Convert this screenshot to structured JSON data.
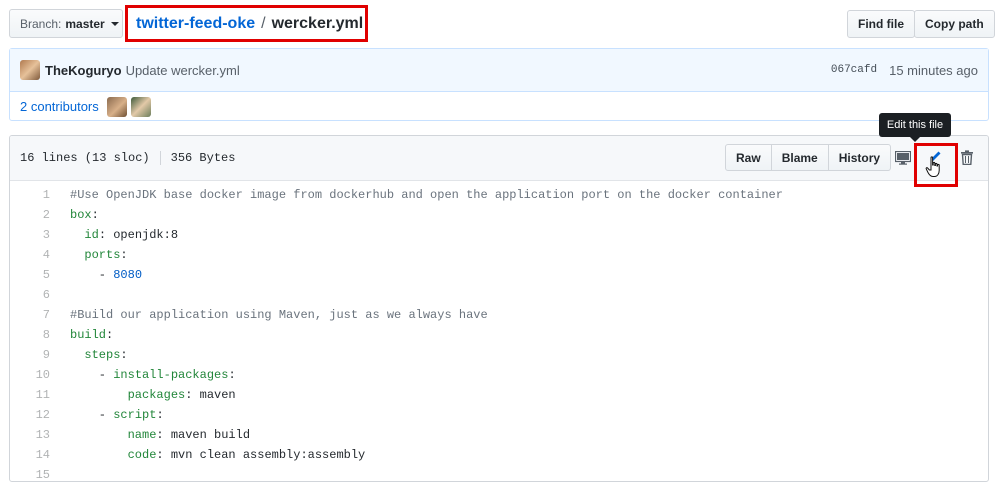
{
  "branch": {
    "prefix": "Branch:",
    "name": "master"
  },
  "breadcrumb": {
    "repo": "twitter-feed-oke",
    "separator": "/",
    "file": "wercker.yml"
  },
  "actions": {
    "find_file": "Find file",
    "copy_path": "Copy path"
  },
  "commit": {
    "author": "TheKoguryo",
    "message": "Update wercker.yml",
    "sha": "067cafd",
    "time": "15 minutes ago"
  },
  "contributors": {
    "label": "2 contributors"
  },
  "file_header": {
    "lines": "16 lines (13 sloc)",
    "size": "356 Bytes",
    "raw": "Raw",
    "blame": "Blame",
    "history": "History"
  },
  "tooltip": "Edit this file",
  "code": [
    {
      "n": "1",
      "parts": [
        {
          "t": "#Use OpenJDK base docker image from dockerhub and open the application port on the docker container",
          "c": "comment"
        }
      ]
    },
    {
      "n": "2",
      "parts": [
        {
          "t": "box",
          "c": "key"
        },
        {
          "t": ":",
          "c": ""
        }
      ]
    },
    {
      "n": "3",
      "parts": [
        {
          "t": "  ",
          "c": ""
        },
        {
          "t": "id",
          "c": "key"
        },
        {
          "t": ": openjdk:8",
          "c": ""
        }
      ]
    },
    {
      "n": "4",
      "parts": [
        {
          "t": "  ",
          "c": ""
        },
        {
          "t": "ports",
          "c": "key"
        },
        {
          "t": ":",
          "c": ""
        }
      ]
    },
    {
      "n": "5",
      "parts": [
        {
          "t": "    - ",
          "c": ""
        },
        {
          "t": "8080",
          "c": "num"
        }
      ]
    },
    {
      "n": "6",
      "parts": []
    },
    {
      "n": "7",
      "parts": [
        {
          "t": "#Build our application using Maven, just as we always have",
          "c": "comment"
        }
      ]
    },
    {
      "n": "8",
      "parts": [
        {
          "t": "build",
          "c": "key"
        },
        {
          "t": ":",
          "c": ""
        }
      ]
    },
    {
      "n": "9",
      "parts": [
        {
          "t": "  ",
          "c": ""
        },
        {
          "t": "steps",
          "c": "key"
        },
        {
          "t": ":",
          "c": ""
        }
      ]
    },
    {
      "n": "10",
      "parts": [
        {
          "t": "    - ",
          "c": ""
        },
        {
          "t": "install-packages",
          "c": "key"
        },
        {
          "t": ":",
          "c": ""
        }
      ]
    },
    {
      "n": "11",
      "parts": [
        {
          "t": "        ",
          "c": ""
        },
        {
          "t": "packages",
          "c": "key"
        },
        {
          "t": ": maven",
          "c": ""
        }
      ]
    },
    {
      "n": "12",
      "parts": [
        {
          "t": "    - ",
          "c": ""
        },
        {
          "t": "script",
          "c": "key"
        },
        {
          "t": ":",
          "c": ""
        }
      ]
    },
    {
      "n": "13",
      "parts": [
        {
          "t": "        ",
          "c": ""
        },
        {
          "t": "name",
          "c": "key"
        },
        {
          "t": ": maven build",
          "c": ""
        }
      ]
    },
    {
      "n": "14",
      "parts": [
        {
          "t": "        ",
          "c": ""
        },
        {
          "t": "code",
          "c": "key"
        },
        {
          "t": ": mvn clean assembly:assembly",
          "c": ""
        }
      ]
    },
    {
      "n": "15",
      "parts": []
    }
  ],
  "icons": {
    "desktop": "desktop-icon",
    "edit": "pencil-icon",
    "cursor": "hand-cursor-icon",
    "delete": "trash-icon"
  },
  "colors": {
    "link": "#0366d6",
    "highlight": "#e00000",
    "key": "#22863a",
    "comment": "#6a737d",
    "number": "#005cc5"
  }
}
